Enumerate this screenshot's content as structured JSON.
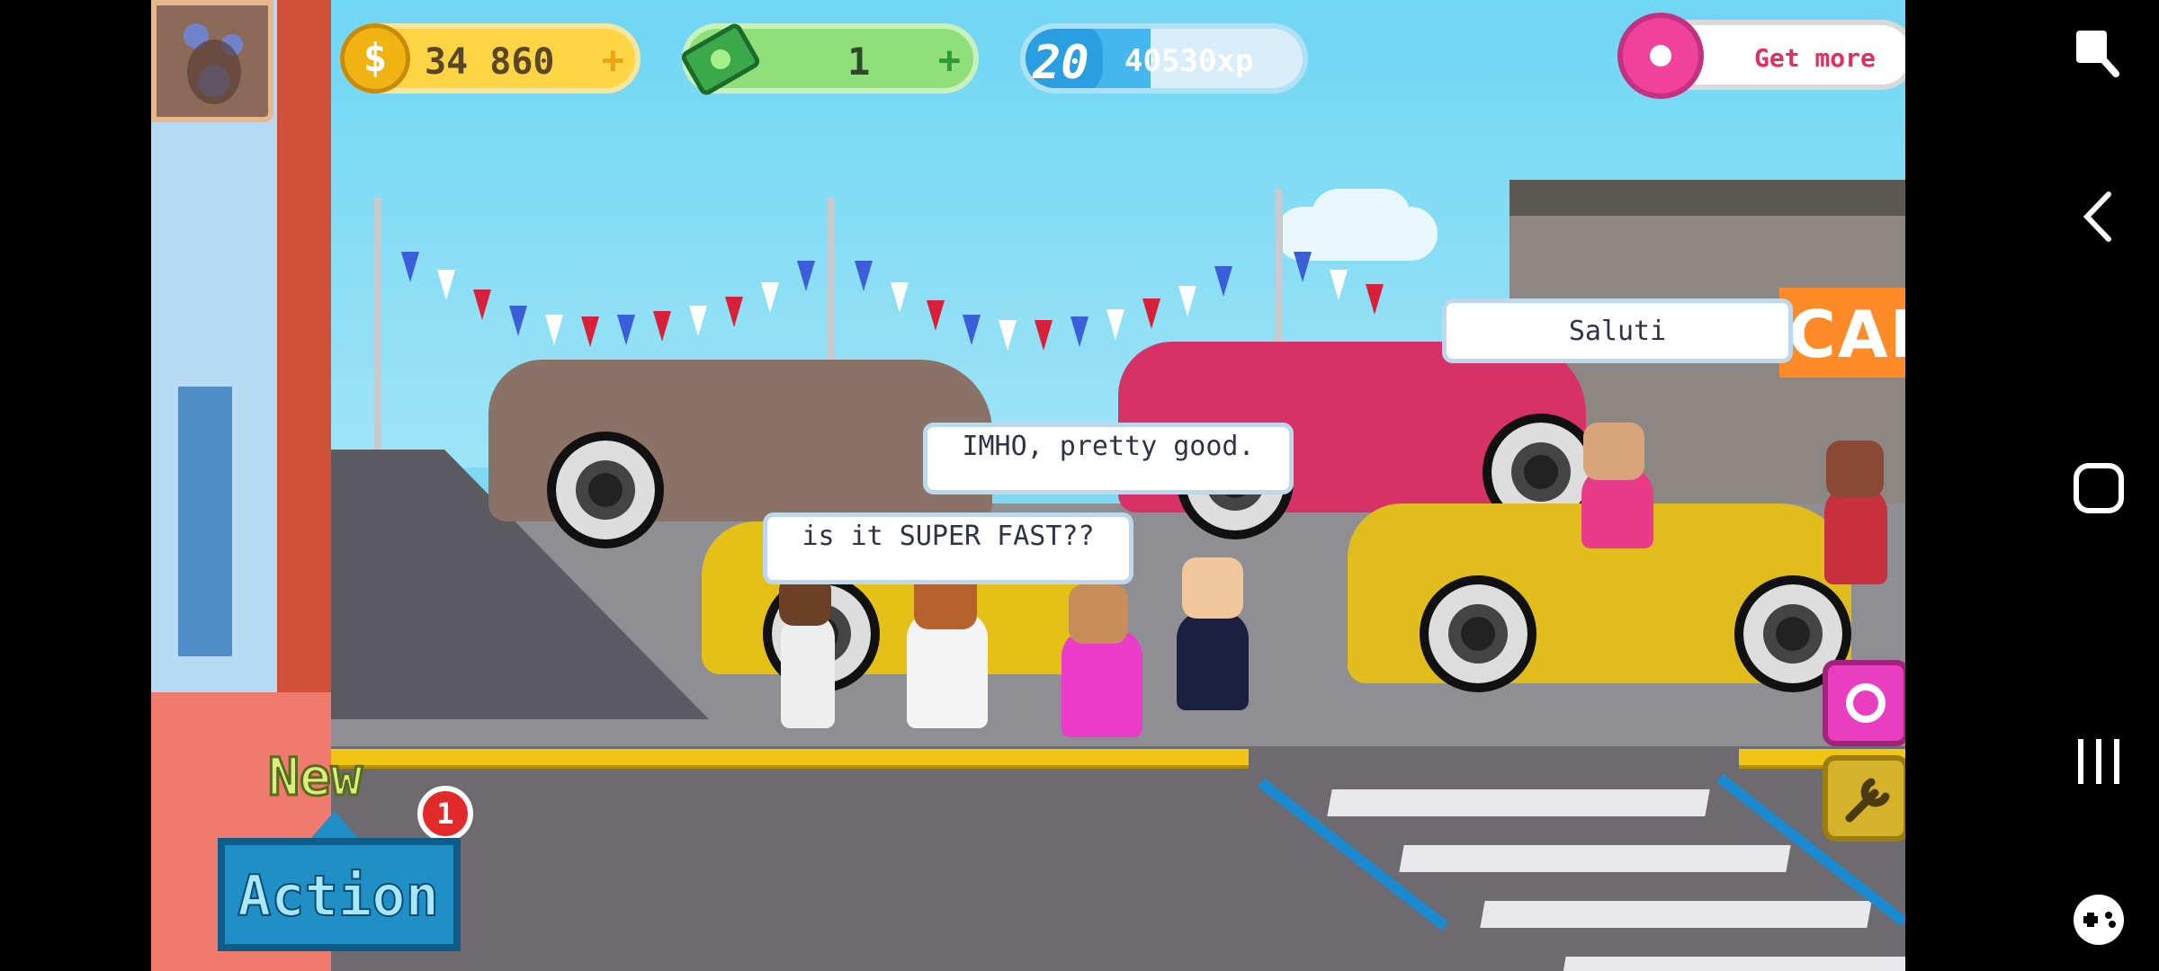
{
  "hud": {
    "coins": "34 860",
    "cash": "1",
    "level": "20",
    "xp": "40530xp",
    "xp_progress": 0.45,
    "get_more_label": "Get more",
    "coin_icon": "dollar-coin-icon",
    "cash_icon": "banknote-icon",
    "plus_icon": "plus-icon"
  },
  "scene": {
    "showroom_sign": "CAR"
  },
  "bubbles": {
    "saluti": "Saluti",
    "imho": "IMHO, pretty good.",
    "super_fast": "is it SUPER FAST??"
  },
  "actions": {
    "new_label": "New",
    "badge_count": "1",
    "action_label": "Action"
  },
  "colors": {
    "coin_bar": "#ffd545",
    "cash_bar": "#8fe07a",
    "xp_bar": "#45b6ee",
    "get_more_text": "#e03060",
    "action_bg": "#1f8fc6",
    "new_text": "#d8f07a"
  },
  "navbar": {
    "icons": [
      "screen-assist-icon",
      "back-icon",
      "home-icon",
      "recents-icon",
      "game-launcher-icon"
    ]
  }
}
